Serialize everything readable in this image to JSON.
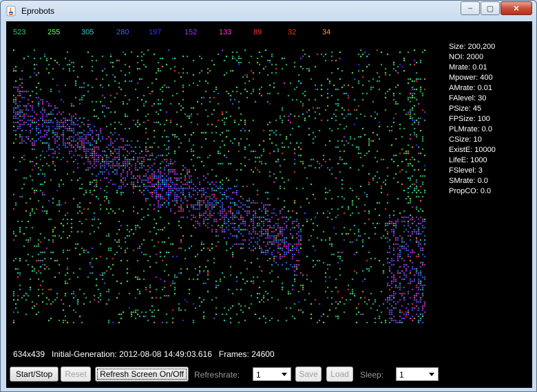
{
  "window": {
    "title": "Eprobots",
    "minimize_glyph": "‒",
    "maximize_glyph": "▢",
    "close_glyph": "✕"
  },
  "counts": [
    {
      "value": "523",
      "color": "#2ecc71"
    },
    {
      "value": "255",
      "color": "#66ff66"
    },
    {
      "value": "305",
      "color": "#33cccc"
    },
    {
      "value": "280",
      "color": "#3366ff"
    },
    {
      "value": "197",
      "color": "#3333ff"
    },
    {
      "value": "152",
      "color": "#9933ff"
    },
    {
      "value": "133",
      "color": "#ff33cc"
    },
    {
      "value": "89",
      "color": "#ff3333"
    },
    {
      "value": "32",
      "color": "#ff3300"
    },
    {
      "value": "34",
      "color": "#ff9933"
    }
  ],
  "stats": [
    "Size: 200,200",
    "NOI: 2000",
    "Mrate: 0.01",
    "Mpower: 400",
    "AMrate: 0.01",
    "FAlevel: 30",
    "PSize: 45",
    "FPSize: 100",
    "PLMrate: 0.0",
    "CSize: 10",
    "ExistE: 10000",
    "LifeE: 1000",
    "FSlevel: 3",
    "SMrate: 0.0",
    "PropCO: 0.0"
  ],
  "footer": {
    "info": "634x439   Initial-Generation: 2012-08-08 14:49:03.616   Frames: 24600"
  },
  "controls": {
    "start_stop": "Start/Stop",
    "reset": "Reset",
    "refresh_toggle": "Refresh Screen On/Off",
    "refreshrate_label": "Refreshrate:",
    "refreshrate_value": "1",
    "save": "Save",
    "load": "Load",
    "sleep_label": "Sleep:",
    "sleep_value": "1"
  },
  "palette": [
    "#2ecc71",
    "#66ff66",
    "#33cccc",
    "#3366ff",
    "#3333ff",
    "#9933ff",
    "#ff33cc",
    "#ff3333",
    "#ff3300",
    "#ff9933",
    "#00ffff"
  ]
}
